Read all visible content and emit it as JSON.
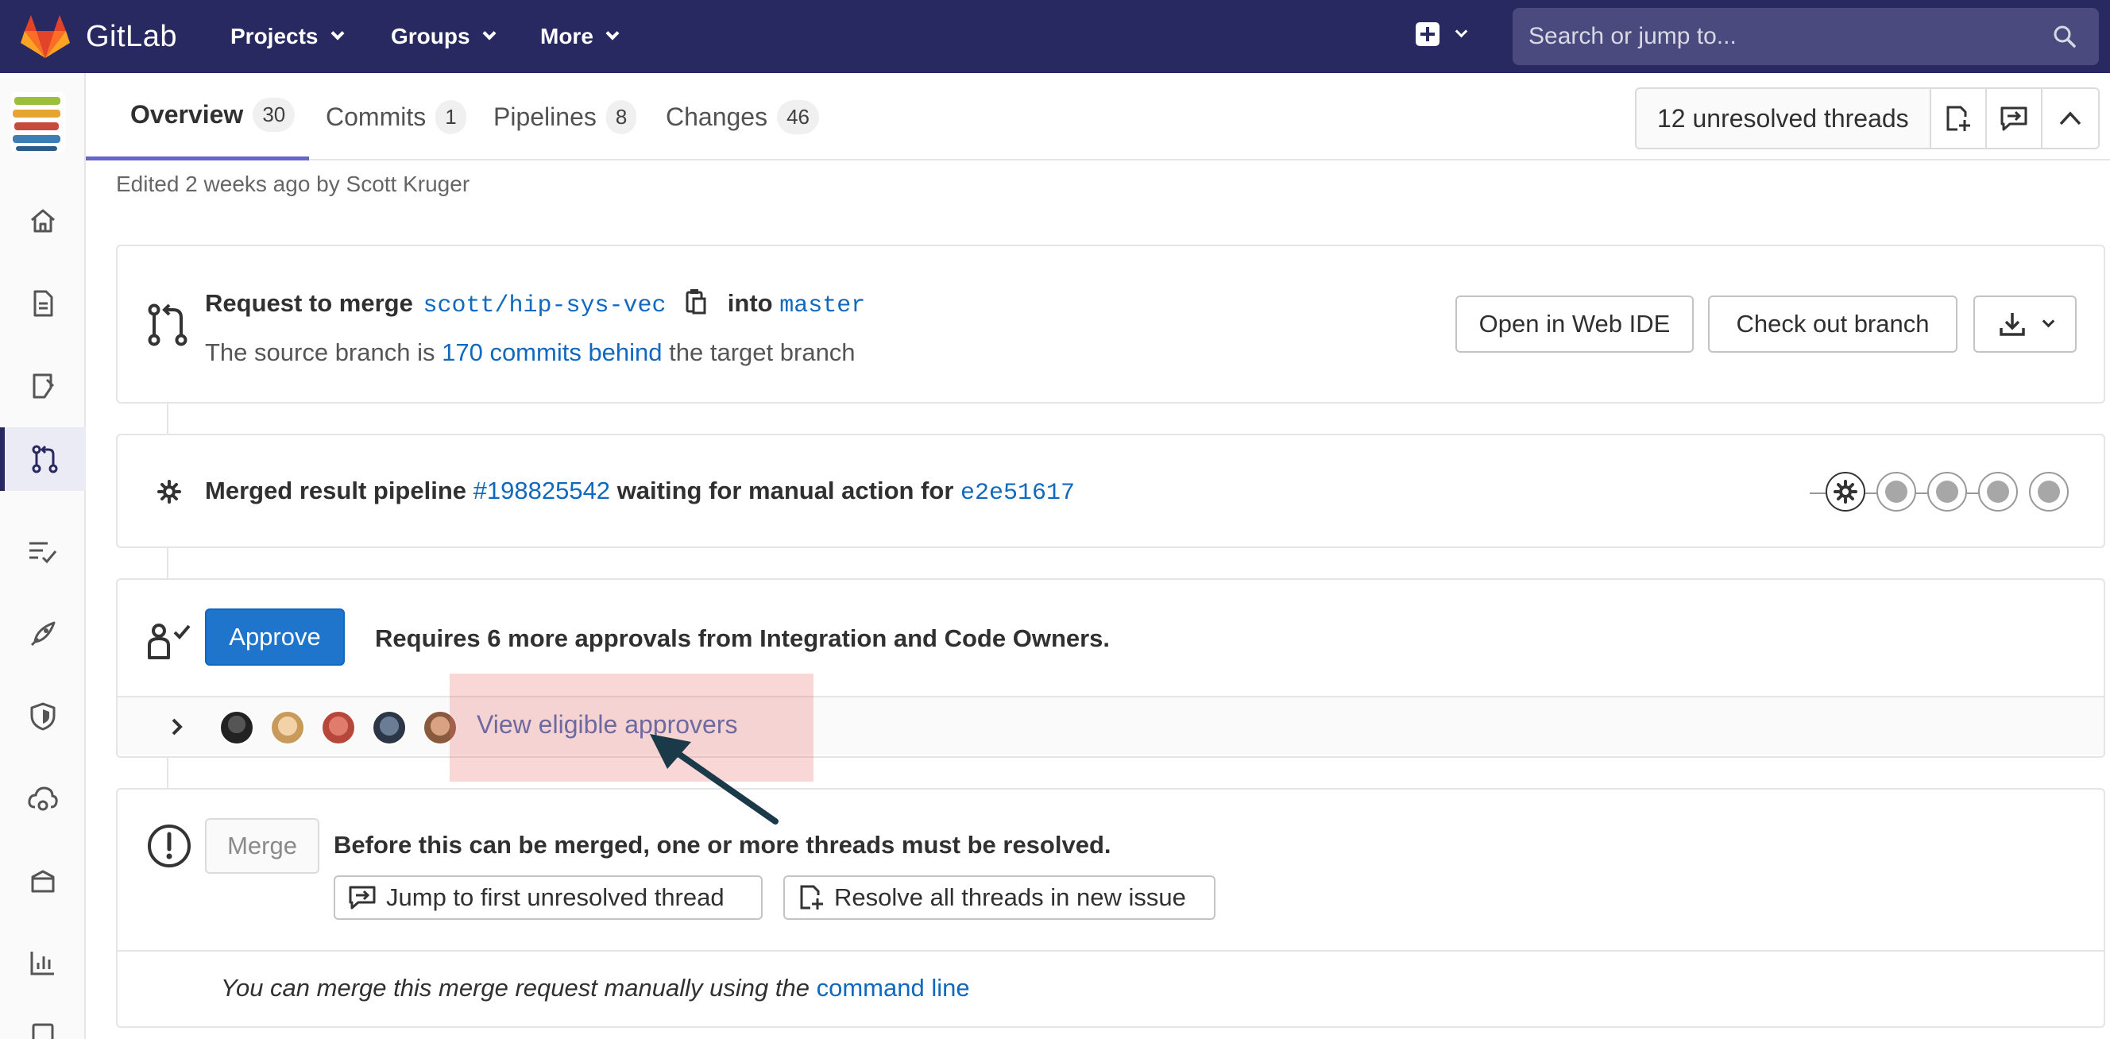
{
  "navbar": {
    "brand": "GitLab",
    "menus": [
      {
        "label": "Projects"
      },
      {
        "label": "Groups"
      },
      {
        "label": "More"
      }
    ],
    "search_placeholder": "Search or jump to..."
  },
  "tabs": [
    {
      "label": "Overview",
      "count": "30"
    },
    {
      "label": "Commits",
      "count": "1"
    },
    {
      "label": "Pipelines",
      "count": "8"
    },
    {
      "label": "Changes",
      "count": "46"
    }
  ],
  "threads": {
    "label": "12 unresolved threads"
  },
  "edited": "Edited 2 weeks ago by Scott Kruger",
  "merge_info": {
    "request_label": "Request to merge",
    "source_branch": "scott/hip-sys-vec",
    "into_label": "into",
    "target_branch": "master",
    "status_prefix": "The source branch is",
    "commits_behind": "170 commits behind",
    "status_suffix": "the target branch",
    "open_web_ide": "Open in Web IDE",
    "check_out": "Check out branch"
  },
  "pipeline": {
    "prefix": "Merged result pipeline",
    "id": "#198825542",
    "middle": "waiting for manual action for",
    "commit": "e2e51617"
  },
  "approval": {
    "approve_label": "Approve",
    "requirement": "Requires 6 more approvals from Integration and Code Owners.",
    "view_approvers": "View eligible approvers"
  },
  "merge": {
    "merge_label": "Merge",
    "blocked_message": "Before this can be merged, one or more threads must be resolved.",
    "jump_thread": "Jump to first unresolved thread",
    "resolve_all": "Resolve all threads in new issue",
    "manual_prefix": "You can merge this merge request manually using the",
    "manual_link": "command line"
  },
  "colors": {
    "navbar": "#292961",
    "link": "#1068bf",
    "primary": "#1f75cb",
    "highlight": "#ec6e6e",
    "arrow": "#1a3a4a"
  }
}
